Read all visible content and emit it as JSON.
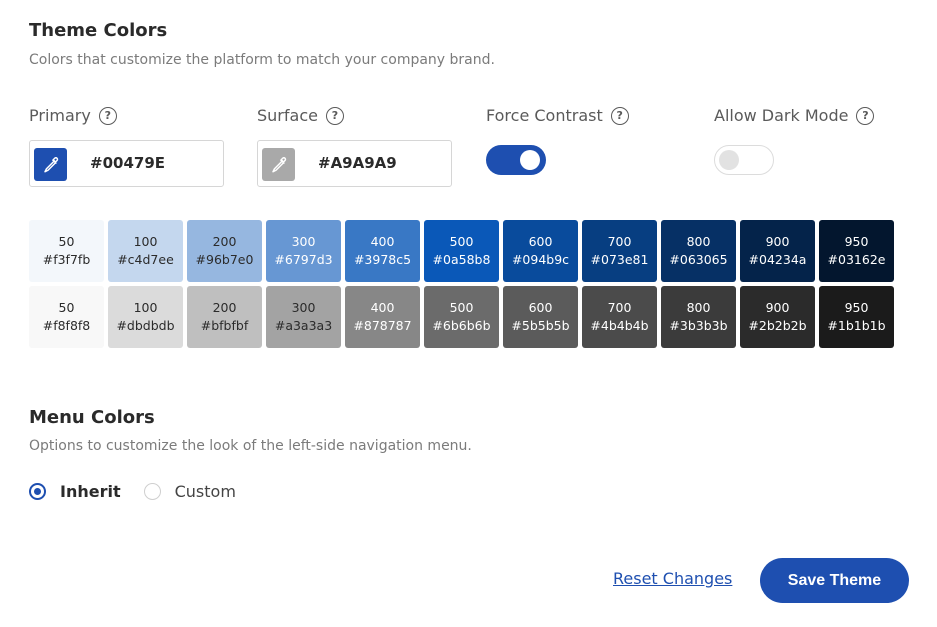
{
  "theme": {
    "title": "Theme Colors",
    "description": "Colors that customize the platform to match your company brand."
  },
  "fields": {
    "primary": {
      "label": "Primary",
      "value": "#00479E",
      "swatch_color": "#1e4fb0"
    },
    "surface": {
      "label": "Surface",
      "value": "#A9A9A9",
      "swatch_color": "#a9a9a9"
    },
    "force_contrast": {
      "label": "Force Contrast",
      "enabled": true
    },
    "allow_dark_mode": {
      "label": "Allow Dark Mode",
      "enabled": false
    }
  },
  "palettes": {
    "primary": [
      {
        "shade": "50",
        "hex": "#f3f7fb"
      },
      {
        "shade": "100",
        "hex": "#c4d7ee"
      },
      {
        "shade": "200",
        "hex": "#96b7e0"
      },
      {
        "shade": "300",
        "hex": "#6797d3"
      },
      {
        "shade": "400",
        "hex": "#3978c5"
      },
      {
        "shade": "500",
        "hex": "#0a58b8"
      },
      {
        "shade": "600",
        "hex": "#094b9c"
      },
      {
        "shade": "700",
        "hex": "#073e81"
      },
      {
        "shade": "800",
        "hex": "#063065"
      },
      {
        "shade": "900",
        "hex": "#04234a"
      },
      {
        "shade": "950",
        "hex": "#03162e"
      }
    ],
    "surface": [
      {
        "shade": "50",
        "hex": "#f8f8f8"
      },
      {
        "shade": "100",
        "hex": "#dbdbdb"
      },
      {
        "shade": "200",
        "hex": "#bfbfbf"
      },
      {
        "shade": "300",
        "hex": "#a3a3a3"
      },
      {
        "shade": "400",
        "hex": "#878787"
      },
      {
        "shade": "500",
        "hex": "#6b6b6b"
      },
      {
        "shade": "600",
        "hex": "#5b5b5b"
      },
      {
        "shade": "700",
        "hex": "#4b4b4b"
      },
      {
        "shade": "800",
        "hex": "#3b3b3b"
      },
      {
        "shade": "900",
        "hex": "#2b2b2b"
      },
      {
        "shade": "950",
        "hex": "#1b1b1b"
      }
    ]
  },
  "menu": {
    "title": "Menu Colors",
    "description": "Options to customize the look of the left-side navigation menu.",
    "options": [
      {
        "label": "Inherit",
        "selected": true
      },
      {
        "label": "Custom",
        "selected": false
      }
    ]
  },
  "actions": {
    "reset_label": "Reset Changes",
    "save_label": "Save Theme"
  },
  "colors": {
    "accent": "#1e4fb0"
  },
  "icons": {
    "help": "help-circle-icon",
    "picker": "eyedropper-icon"
  }
}
